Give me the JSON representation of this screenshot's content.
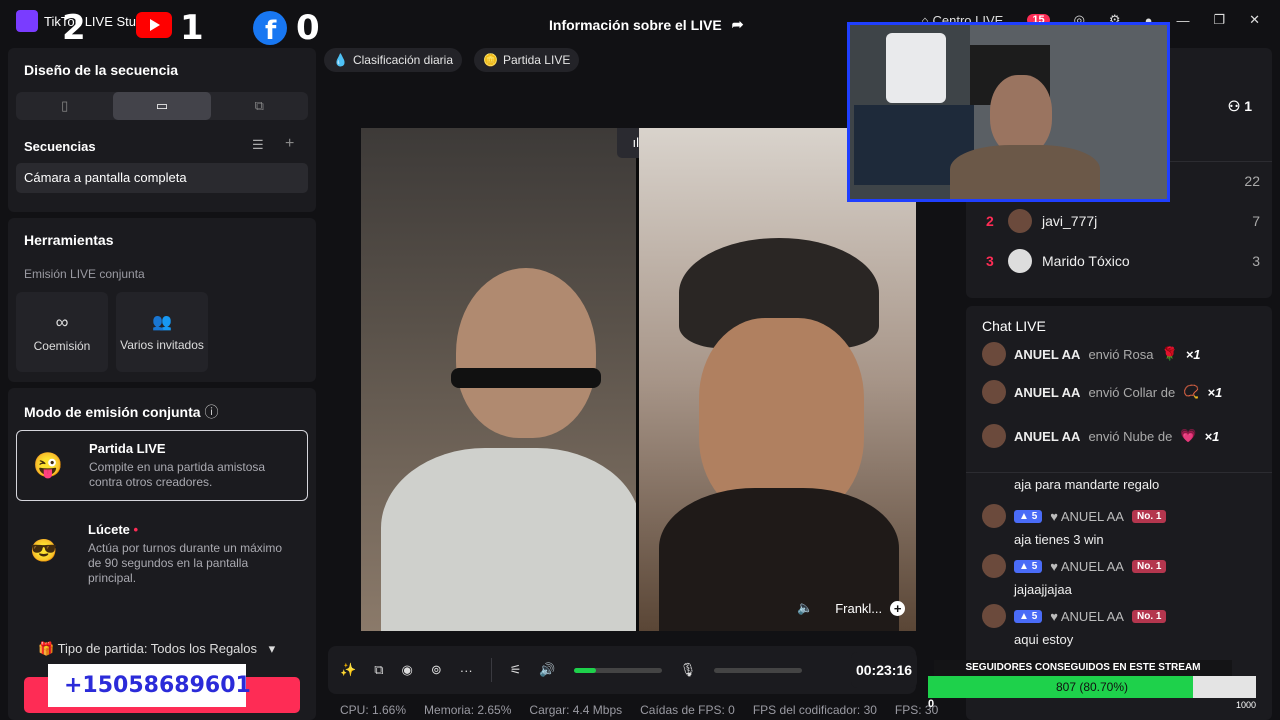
{
  "app": {
    "title": "TikTok LIVE Studio"
  },
  "overlay": {
    "twitch_count": "2",
    "youtube_count": "1",
    "facebook_count": "0"
  },
  "header": {
    "title": "Información sobre el LIVE",
    "center_label": "Centro LIVE",
    "notif_count": "15"
  },
  "left": {
    "sequence_design_title": "Diseño de la secuencia",
    "sequences_title": "Secuencias",
    "sequence_item": "Cámara a pantalla completa",
    "tools_title": "Herramientas",
    "coop_label": "Emisión LIVE conjunta",
    "tool_cohost": "Coemisión",
    "tool_multi": "Varios invitados",
    "mode_title": "Modo de emisión conjunta",
    "mode1_title": "Partida LIVE",
    "mode1_desc": "Compite en una partida amistosa contra otros creadores.",
    "mode2_title": "Lúcete",
    "mode2_desc": "Actúa por turnos durante un máximo de 90 segundos en la pantalla principal.",
    "match_type": "Tipo de partida: Todos los Regalos",
    "whatsapp": "+15058689601"
  },
  "chips": [
    "Clasificación diaria",
    "Partida LIVE"
  ],
  "video": {
    "guest_name": "Frankl..."
  },
  "controls": {
    "time": "00:23:16",
    "volume_level": 0.25
  },
  "status": {
    "cpu": "CPU:  1.66%",
    "mem": "Memoria:  2.65%",
    "upload": "Cargar:  4.4 Mbps",
    "fps_drops": "Caídas de FPS:  0",
    "enc_fps": "FPS del codificador:  30",
    "fps": "FPS:  30"
  },
  "viewers": {
    "count": "1"
  },
  "ranking": [
    {
      "rank": "",
      "name": "",
      "score": "22"
    },
    {
      "rank": "2",
      "name": "javi_777j",
      "score": "7"
    },
    {
      "rank": "3",
      "name": "Marido Tóxico",
      "score": "3"
    }
  ],
  "chat": {
    "title": "Chat LIVE",
    "gifts": [
      {
        "name": "ANUEL AA",
        "text": "envió Rosa",
        "count": "×1"
      },
      {
        "name": "ANUEL AA",
        "text": "envió Collar de",
        "count": "×1"
      },
      {
        "name": "ANUEL AA",
        "text": "envió Nube de",
        "count": "×1"
      }
    ],
    "first_msg": "aja para mandarte regalo",
    "messages": [
      {
        "level": "5",
        "name": "ANUEL AA",
        "badge": "No. 1",
        "text": "aja tienes 3 win"
      },
      {
        "level": "5",
        "name": "ANUEL AA",
        "badge": "No. 1",
        "text": "jajaajjajaa"
      },
      {
        "level": "5",
        "name": "ANUEL AA",
        "badge": "No. 1",
        "text": "aqui estoy"
      }
    ]
  },
  "followers": {
    "title": "SEGUIDORES CONSEGUIDOS EN ESTE STREAM",
    "value_label": "807 (80.70%)",
    "fraction": 0.807,
    "min": "0",
    "max": "1000"
  },
  "colors": {
    "accent": "#fe2c55",
    "progress": "#1ed14b",
    "pip_border": "#1f3fff"
  }
}
